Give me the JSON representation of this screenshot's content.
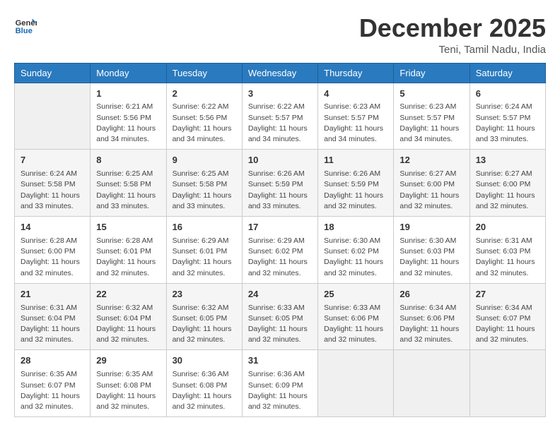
{
  "header": {
    "logo_general": "General",
    "logo_blue": "Blue",
    "month_title": "December 2025",
    "location": "Teni, Tamil Nadu, India"
  },
  "columns": [
    "Sunday",
    "Monday",
    "Tuesday",
    "Wednesday",
    "Thursday",
    "Friday",
    "Saturday"
  ],
  "weeks": [
    [
      {
        "day": "",
        "sunrise": "",
        "sunset": "",
        "daylight": ""
      },
      {
        "day": "1",
        "sunrise": "Sunrise: 6:21 AM",
        "sunset": "Sunset: 5:56 PM",
        "daylight": "Daylight: 11 hours and 34 minutes."
      },
      {
        "day": "2",
        "sunrise": "Sunrise: 6:22 AM",
        "sunset": "Sunset: 5:56 PM",
        "daylight": "Daylight: 11 hours and 34 minutes."
      },
      {
        "day": "3",
        "sunrise": "Sunrise: 6:22 AM",
        "sunset": "Sunset: 5:57 PM",
        "daylight": "Daylight: 11 hours and 34 minutes."
      },
      {
        "day": "4",
        "sunrise": "Sunrise: 6:23 AM",
        "sunset": "Sunset: 5:57 PM",
        "daylight": "Daylight: 11 hours and 34 minutes."
      },
      {
        "day": "5",
        "sunrise": "Sunrise: 6:23 AM",
        "sunset": "Sunset: 5:57 PM",
        "daylight": "Daylight: 11 hours and 34 minutes."
      },
      {
        "day": "6",
        "sunrise": "Sunrise: 6:24 AM",
        "sunset": "Sunset: 5:57 PM",
        "daylight": "Daylight: 11 hours and 33 minutes."
      }
    ],
    [
      {
        "day": "7",
        "sunrise": "Sunrise: 6:24 AM",
        "sunset": "Sunset: 5:58 PM",
        "daylight": "Daylight: 11 hours and 33 minutes."
      },
      {
        "day": "8",
        "sunrise": "Sunrise: 6:25 AM",
        "sunset": "Sunset: 5:58 PM",
        "daylight": "Daylight: 11 hours and 33 minutes."
      },
      {
        "day": "9",
        "sunrise": "Sunrise: 6:25 AM",
        "sunset": "Sunset: 5:58 PM",
        "daylight": "Daylight: 11 hours and 33 minutes."
      },
      {
        "day": "10",
        "sunrise": "Sunrise: 6:26 AM",
        "sunset": "Sunset: 5:59 PM",
        "daylight": "Daylight: 11 hours and 33 minutes."
      },
      {
        "day": "11",
        "sunrise": "Sunrise: 6:26 AM",
        "sunset": "Sunset: 5:59 PM",
        "daylight": "Daylight: 11 hours and 32 minutes."
      },
      {
        "day": "12",
        "sunrise": "Sunrise: 6:27 AM",
        "sunset": "Sunset: 6:00 PM",
        "daylight": "Daylight: 11 hours and 32 minutes."
      },
      {
        "day": "13",
        "sunrise": "Sunrise: 6:27 AM",
        "sunset": "Sunset: 6:00 PM",
        "daylight": "Daylight: 11 hours and 32 minutes."
      }
    ],
    [
      {
        "day": "14",
        "sunrise": "Sunrise: 6:28 AM",
        "sunset": "Sunset: 6:00 PM",
        "daylight": "Daylight: 11 hours and 32 minutes."
      },
      {
        "day": "15",
        "sunrise": "Sunrise: 6:28 AM",
        "sunset": "Sunset: 6:01 PM",
        "daylight": "Daylight: 11 hours and 32 minutes."
      },
      {
        "day": "16",
        "sunrise": "Sunrise: 6:29 AM",
        "sunset": "Sunset: 6:01 PM",
        "daylight": "Daylight: 11 hours and 32 minutes."
      },
      {
        "day": "17",
        "sunrise": "Sunrise: 6:29 AM",
        "sunset": "Sunset: 6:02 PM",
        "daylight": "Daylight: 11 hours and 32 minutes."
      },
      {
        "day": "18",
        "sunrise": "Sunrise: 6:30 AM",
        "sunset": "Sunset: 6:02 PM",
        "daylight": "Daylight: 11 hours and 32 minutes."
      },
      {
        "day": "19",
        "sunrise": "Sunrise: 6:30 AM",
        "sunset": "Sunset: 6:03 PM",
        "daylight": "Daylight: 11 hours and 32 minutes."
      },
      {
        "day": "20",
        "sunrise": "Sunrise: 6:31 AM",
        "sunset": "Sunset: 6:03 PM",
        "daylight": "Daylight: 11 hours and 32 minutes."
      }
    ],
    [
      {
        "day": "21",
        "sunrise": "Sunrise: 6:31 AM",
        "sunset": "Sunset: 6:04 PM",
        "daylight": "Daylight: 11 hours and 32 minutes."
      },
      {
        "day": "22",
        "sunrise": "Sunrise: 6:32 AM",
        "sunset": "Sunset: 6:04 PM",
        "daylight": "Daylight: 11 hours and 32 minutes."
      },
      {
        "day": "23",
        "sunrise": "Sunrise: 6:32 AM",
        "sunset": "Sunset: 6:05 PM",
        "daylight": "Daylight: 11 hours and 32 minutes."
      },
      {
        "day": "24",
        "sunrise": "Sunrise: 6:33 AM",
        "sunset": "Sunset: 6:05 PM",
        "daylight": "Daylight: 11 hours and 32 minutes."
      },
      {
        "day": "25",
        "sunrise": "Sunrise: 6:33 AM",
        "sunset": "Sunset: 6:06 PM",
        "daylight": "Daylight: 11 hours and 32 minutes."
      },
      {
        "day": "26",
        "sunrise": "Sunrise: 6:34 AM",
        "sunset": "Sunset: 6:06 PM",
        "daylight": "Daylight: 11 hours and 32 minutes."
      },
      {
        "day": "27",
        "sunrise": "Sunrise: 6:34 AM",
        "sunset": "Sunset: 6:07 PM",
        "daylight": "Daylight: 11 hours and 32 minutes."
      }
    ],
    [
      {
        "day": "28",
        "sunrise": "Sunrise: 6:35 AM",
        "sunset": "Sunset: 6:07 PM",
        "daylight": "Daylight: 11 hours and 32 minutes."
      },
      {
        "day": "29",
        "sunrise": "Sunrise: 6:35 AM",
        "sunset": "Sunset: 6:08 PM",
        "daylight": "Daylight: 11 hours and 32 minutes."
      },
      {
        "day": "30",
        "sunrise": "Sunrise: 6:36 AM",
        "sunset": "Sunset: 6:08 PM",
        "daylight": "Daylight: 11 hours and 32 minutes."
      },
      {
        "day": "31",
        "sunrise": "Sunrise: 6:36 AM",
        "sunset": "Sunset: 6:09 PM",
        "daylight": "Daylight: 11 hours and 32 minutes."
      },
      {
        "day": "",
        "sunrise": "",
        "sunset": "",
        "daylight": ""
      },
      {
        "day": "",
        "sunrise": "",
        "sunset": "",
        "daylight": ""
      },
      {
        "day": "",
        "sunrise": "",
        "sunset": "",
        "daylight": ""
      }
    ]
  ]
}
